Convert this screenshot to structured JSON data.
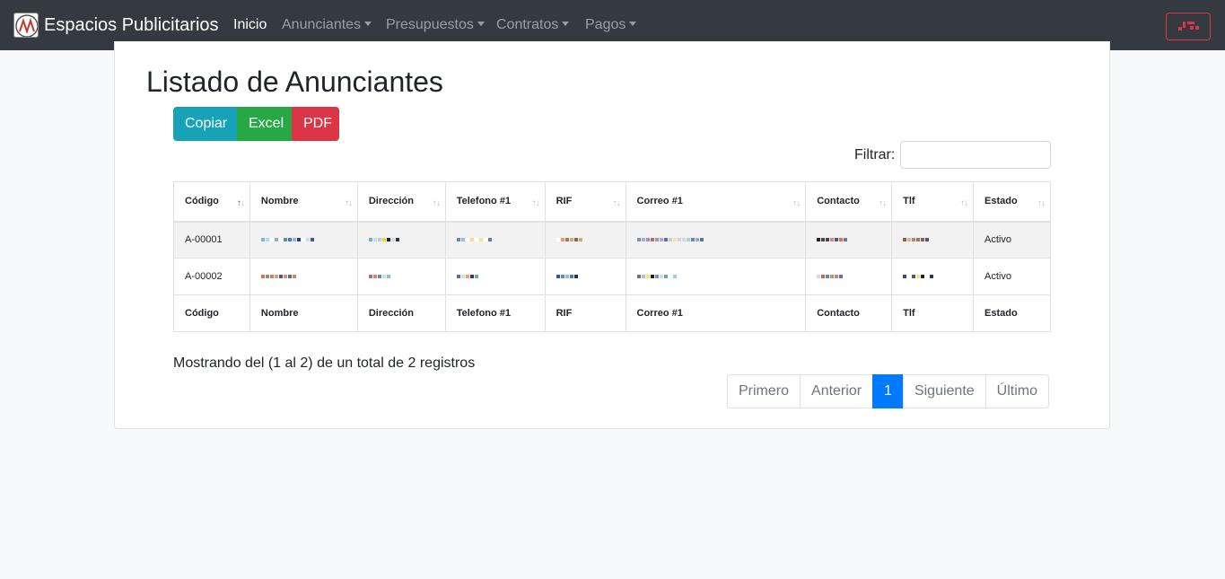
{
  "navbar": {
    "brand": "Espacios Publicitarios",
    "items": [
      {
        "label": "Inicio",
        "active": true,
        "dropdown": false
      },
      {
        "label": "Anunciantes",
        "active": false,
        "dropdown": true
      },
      {
        "label": "Presupuestos",
        "active": false,
        "dropdown": true
      },
      {
        "label": "Contratos",
        "active": false,
        "dropdown": true
      },
      {
        "label": "Pagos",
        "active": false,
        "dropdown": true
      }
    ],
    "right_button_color": "#dc3545"
  },
  "page": {
    "title": "Listado de Anunciantes"
  },
  "export_buttons": {
    "copy": "Copiar",
    "excel": "Excel",
    "pdf": "PDF"
  },
  "filter": {
    "label": "Filtrar:",
    "value": ""
  },
  "table": {
    "columns": [
      "Código",
      "Nombre",
      "Dirección",
      "Telefono #1",
      "RIF",
      "Correo #1",
      "Contacto",
      "Tlf",
      "Estado"
    ],
    "rows": [
      {
        "codigo": "A-00001",
        "estado": "Activo"
      },
      {
        "codigo": "A-00002",
        "estado": "Activo"
      }
    ],
    "sorted_column": "Código"
  },
  "summary": {
    "info": "Mostrando del (1 al 2) de un total de 2 registros"
  },
  "pagination": {
    "first": "Primero",
    "previous": "Anterior",
    "current": "1",
    "next": "Siguiente",
    "last": "Último"
  },
  "colors": {
    "navbar": "#343a40",
    "copy": "#17a2b8",
    "excel": "#28a745",
    "pdf": "#dc3545",
    "page_active": "#007bff"
  }
}
